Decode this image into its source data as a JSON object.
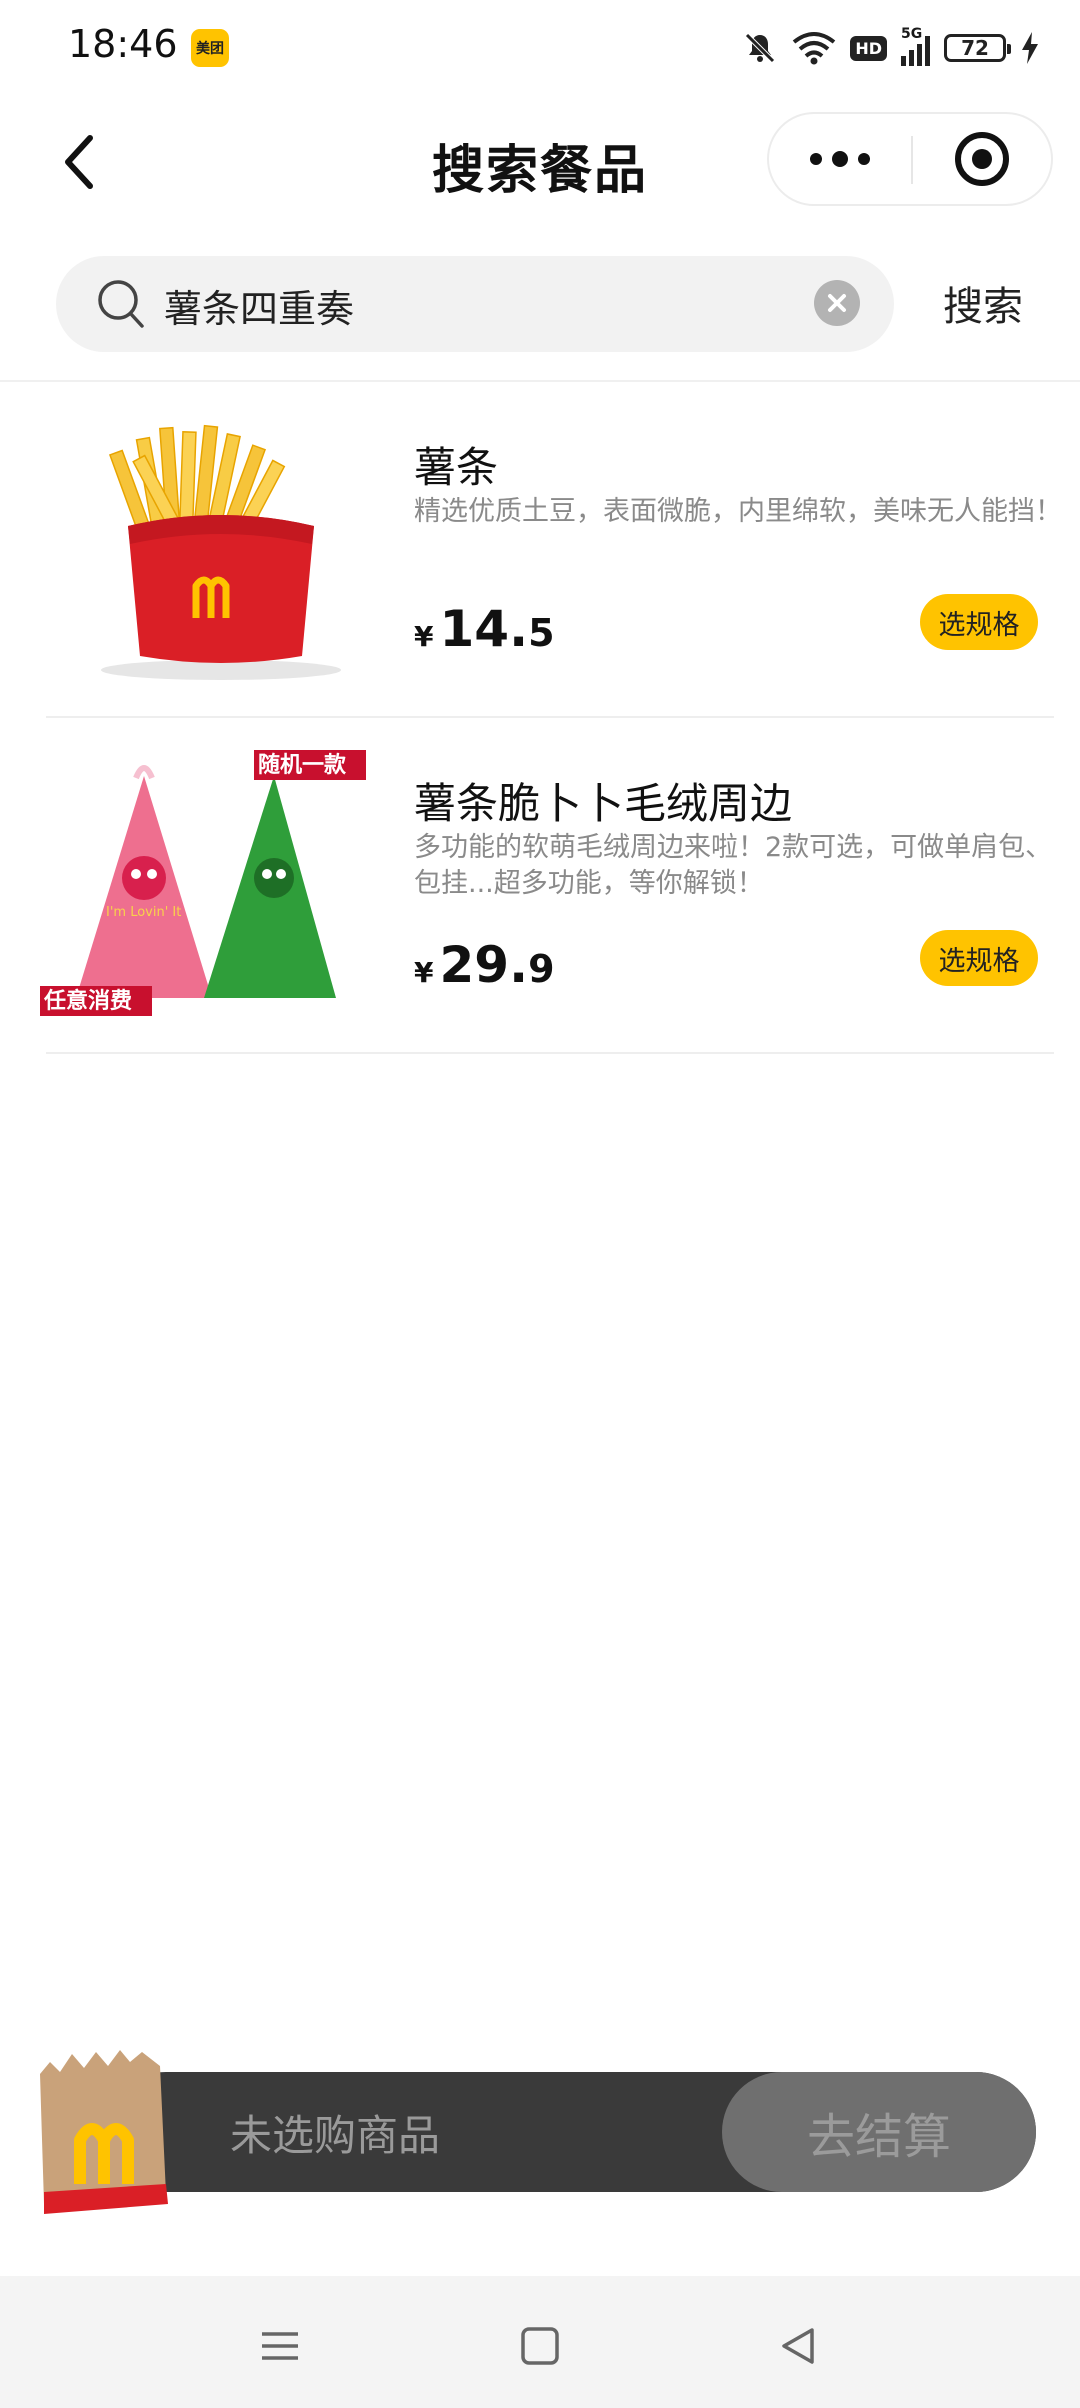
{
  "status_bar": {
    "time": "18:46",
    "app_badge": "美团",
    "network": "5G",
    "hd": "HD",
    "battery": "72"
  },
  "nav": {
    "title": "搜索餐品",
    "back_icon": "chevron-left-icon",
    "more_icon": "more-dots-icon",
    "close_icon": "target-circle-icon"
  },
  "search": {
    "value": "薯条四重奏",
    "button_label": "搜索"
  },
  "products": [
    {
      "name": "薯条",
      "description": "精选优质土豆，表面微脆，内里绵软，美味无人能挡！",
      "currency": "¥",
      "price_int": "14.",
      "price_dec": "5",
      "action": "选规格"
    },
    {
      "name": "薯条脆卜卜毛绒周边",
      "description": "多功能的软萌毛绒周边来啦！2款可选，可做单肩包、包挂...超多功能，等你解锁！",
      "currency": "¥",
      "price_int": "29.",
      "price_dec": "9",
      "action": "选规格",
      "image_tag_top": "随机一款",
      "image_tag_bottom": "任意消费",
      "bag_text": "I'm Lovin' It"
    }
  ],
  "cart": {
    "status": "未选购商品",
    "checkout_label": "去结算"
  },
  "colors": {
    "accent": "#ffc300",
    "brand_red": "#da1f26",
    "cart_bg": "#3a3a3a"
  }
}
